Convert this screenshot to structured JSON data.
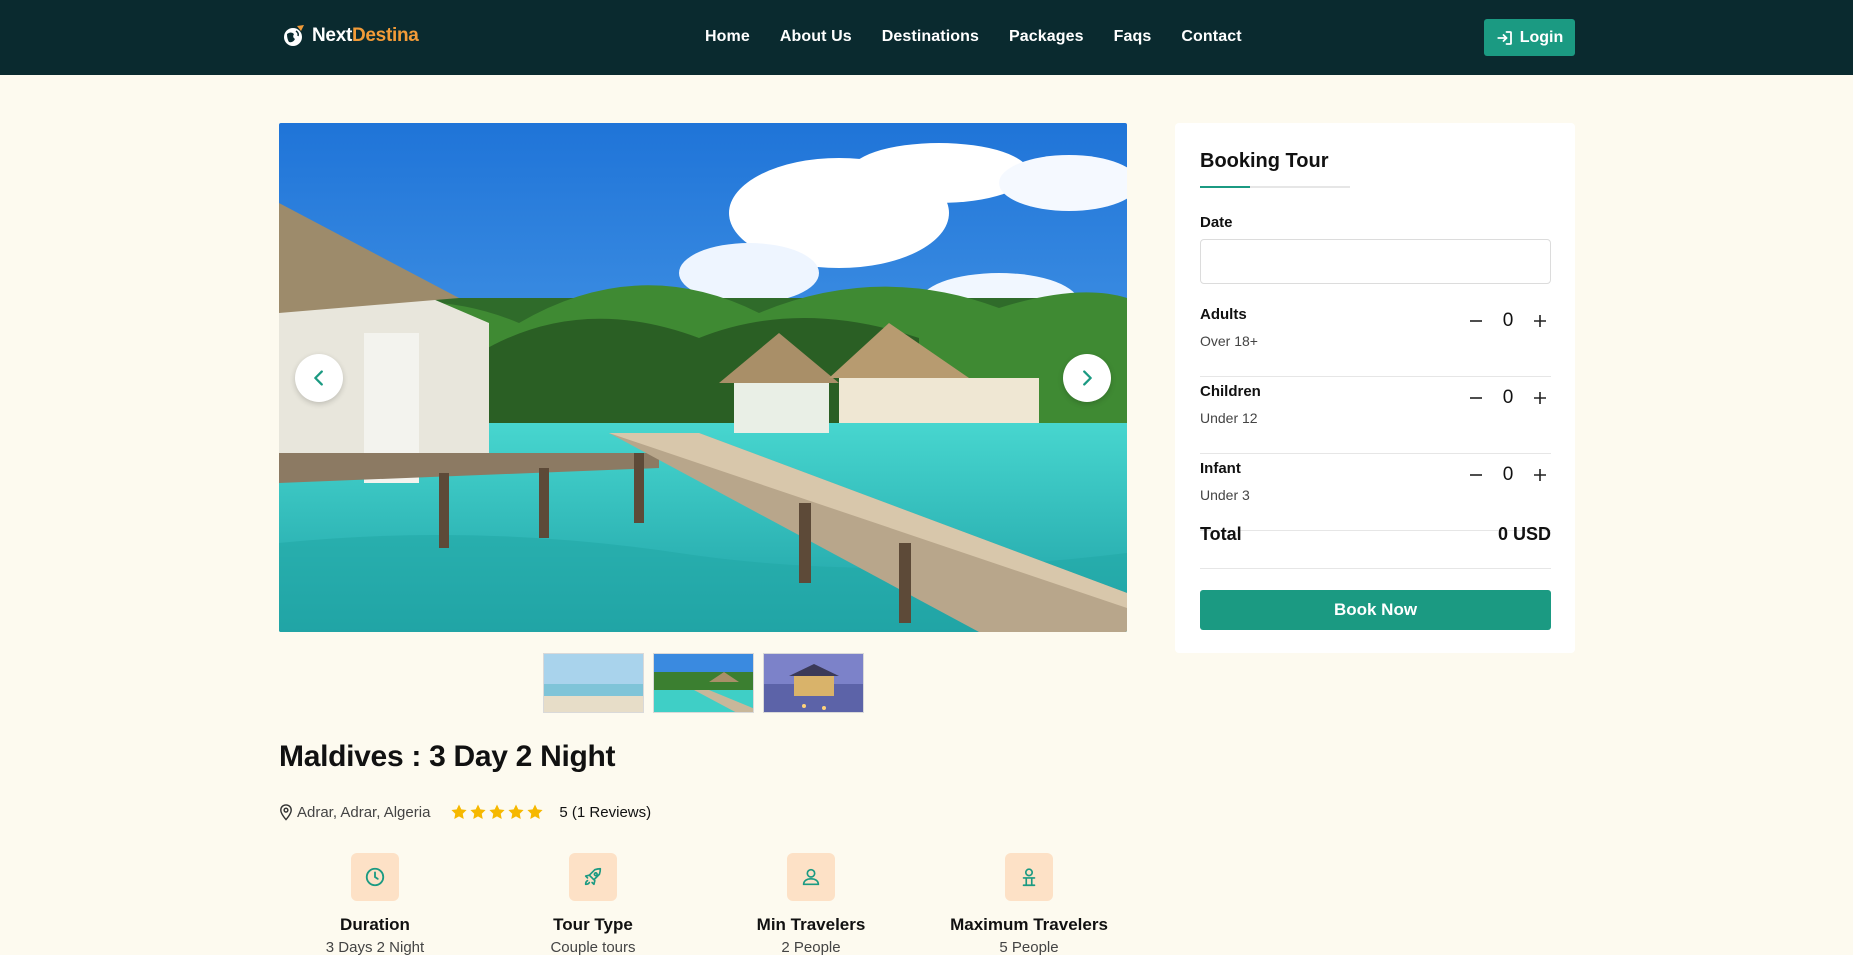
{
  "header": {
    "logo": {
      "part1": "Next",
      "part2": "Destina"
    },
    "nav": [
      "Home",
      "About Us",
      "Destinations",
      "Packages",
      "Faqs",
      "Contact"
    ],
    "login_label": "Login"
  },
  "gallery": {
    "thumbnail_count": 3,
    "selected_thumbnail": 2,
    "icons": {
      "prev": "chevron-left-icon",
      "next": "chevron-right-icon"
    }
  },
  "tour": {
    "title": "Maldives : 3 Day 2 Night",
    "location": "Adrar, Adrar, Algeria",
    "stars": 5,
    "rating_text": "5 (1 Reviews)",
    "features": [
      {
        "icon": "clock-icon",
        "title": "Duration",
        "value": "3 Days 2 Night"
      },
      {
        "icon": "rocket-icon",
        "title": "Tour Type",
        "value": "Couple tours"
      },
      {
        "icon": "user-icon",
        "title": "Min Travelers",
        "value": "2 People"
      },
      {
        "icon": "user-group-icon",
        "title": "Maximum Travelers",
        "value": "5 People"
      }
    ]
  },
  "booking": {
    "title": "Booking Tour",
    "date_label": "Date",
    "date_value": "",
    "travelers": [
      {
        "label": "Adults",
        "sub": "Over 18+",
        "count": "0"
      },
      {
        "label": "Children",
        "sub": "Under 12",
        "count": "0"
      },
      {
        "label": "Infant",
        "sub": "Under 3",
        "count": "0"
      }
    ],
    "total_label": "Total",
    "total_value": "0 USD",
    "book_label": "Book Now"
  },
  "colors": {
    "header_bg": "#0a2a2f",
    "accent": "#1b9a82",
    "logo_orange": "#f29b38",
    "page_bg": "#fdfaef",
    "icon_tile": "#fde1c6",
    "star": "#f6b800"
  }
}
